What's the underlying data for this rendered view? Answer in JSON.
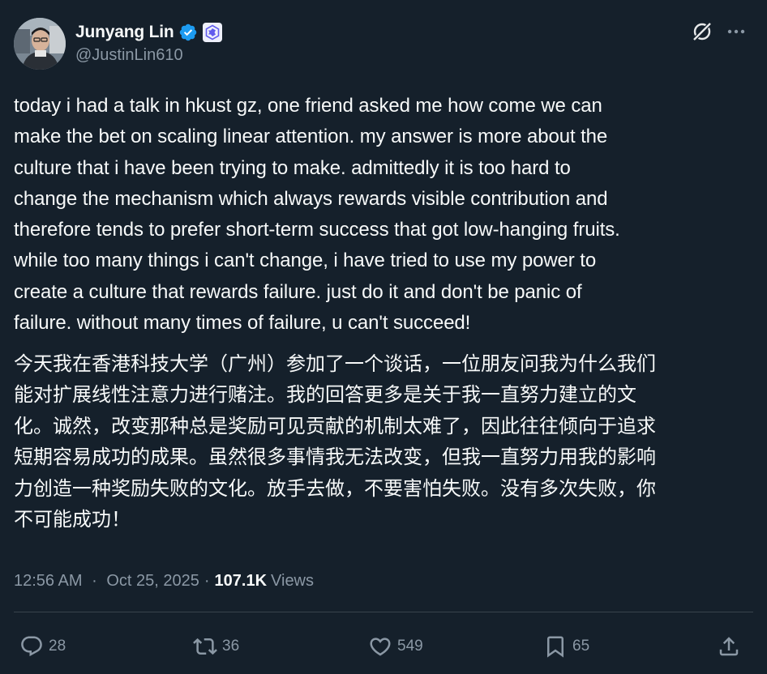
{
  "author": {
    "display_name": "Junyang Lin",
    "handle": "@JustinLin610",
    "verified_icon": "verified-badge-icon",
    "affiliation_icon": "affiliation-badge-icon"
  },
  "tweet": {
    "en_lines": [
      "today i had a talk in hkust gz, one friend asked me how come we can",
      "make the bet on scaling linear attention. my answer is more about the",
      "culture that i have been trying to make. admittedly it is too hard to",
      "change the mechanism which always rewards visible contribution and",
      "therefore tends to prefer short-term success that got low-hanging fruits.",
      "while too many things i can't change, i have tried to use my power to",
      "create a culture that rewards failure. just do it and don't be panic of",
      "failure. without many times of failure, u can't succeed!"
    ],
    "cn_lines": [
      "今天我在香港科技大学（广州）参加了一个谈话，一位朋友问我为什么我们",
      "能对扩展线性注意力进行赌注。我的回答更多是关于我一直努力建立的文",
      "化。诚然，改变那种总是奖励可见贡献的机制太难了，因此往往倾向于追求",
      "短期容易成功的成果。虽然很多事情我无法改变，但我一直努力用我的影响",
      "力创造一种奖励失败的文化。放手去做，不要害怕失败。没有多次失败，你",
      "不可能成功！"
    ]
  },
  "meta": {
    "time": "12:56 AM",
    "separator": "·",
    "date": "Oct 25, 2025",
    "views_count": "107.1K",
    "views_label": "Views"
  },
  "actions": {
    "reply_count": "28",
    "repost_count": "36",
    "like_count": "549",
    "bookmark_count": "65"
  },
  "colors": {
    "background": "#15202b",
    "text_primary": "#f7f9f9",
    "text_secondary": "#8b98a5",
    "verified_blue": "#1d9bf0",
    "divider": "#38444d"
  }
}
